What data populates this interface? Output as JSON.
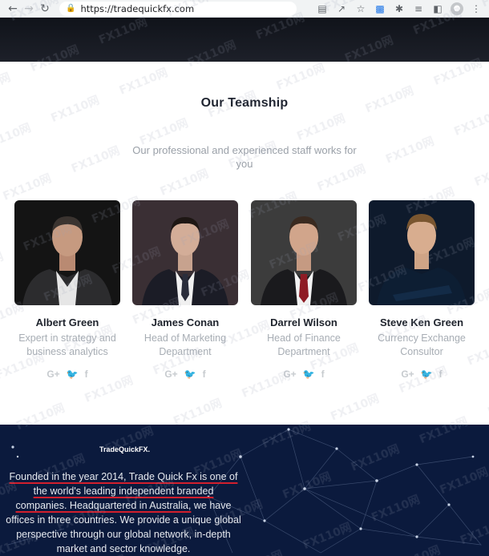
{
  "browser": {
    "url": "https://tradequickfx.com",
    "icons": [
      "back-icon",
      "forward-icon",
      "reload-icon",
      "lock-icon",
      "translate-icon",
      "share-icon",
      "star-icon",
      "extension-s-icon",
      "puzzle-icon",
      "reading-list-icon",
      "sidepanel-icon",
      "profile-icon",
      "menu-icon"
    ]
  },
  "team": {
    "title": "Our Teamship",
    "subtitle": "Our professional and experienced staff works for you",
    "members": [
      {
        "name": "Albert Green",
        "role": "Expert in strategy and business analytics"
      },
      {
        "name": "James Conan",
        "role": "Head of Marketing Department"
      },
      {
        "name": "Darrel Wilson",
        "role": "Head of Finance Department"
      },
      {
        "name": "Steve Ken Green",
        "role": "Currency Exchange Consultor"
      }
    ],
    "social": {
      "google": "G+",
      "twitter": "twitter-icon",
      "facebook": "f"
    }
  },
  "footer": {
    "brand": "TradeQuickFX.",
    "about_parts": [
      "Founded in the year 2014, Trade Quick Fx is one of",
      "the world's leading independent branded",
      "companies. Headquartered in Australia,",
      " we have offices in three countries. We provide a unique global perspective through our global network, in-depth market and sector knowledge."
    ],
    "colors": {
      "background": "#0b1a3d",
      "underline": "#d21f2d"
    }
  },
  "watermark": "FX110网"
}
